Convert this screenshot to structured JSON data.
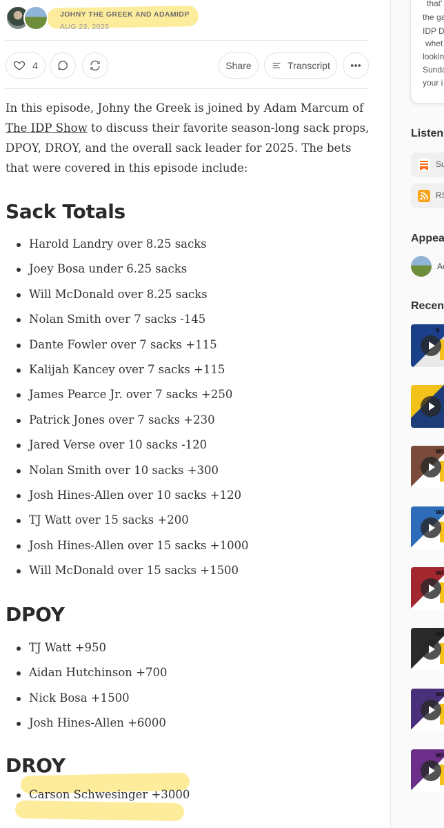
{
  "byline": {
    "authors": "JOHNY THE GREEK AND ADAMIDP",
    "date": "AUG 23, 2025"
  },
  "actions": {
    "like_count": "4",
    "share_label": "Share",
    "transcript_label": "Transcript"
  },
  "intro": {
    "before_link": "In this episode, Johny the Greek is joined by Adam Marcum of ",
    "link_text": "The IDP Show",
    "after_link": " to discuss their favorite season-long sack props, DPOY, DROY, and the overall sack leader for 2025. The bets that were covered in this episode include:"
  },
  "sections": [
    {
      "title": "Sack Totals",
      "items": [
        "Harold Landry over 8.25 sacks",
        "Joey Bosa under 6.25 sacks",
        "Will McDonald over 8.25 sacks",
        "Nolan Smith over 7 sacks -145",
        "Dante Fowler over 7 sacks +115",
        "Kalijah Kancey over 7 sacks +115",
        "James Pearce Jr. over 7 sacks +250",
        "Patrick Jones over 7 sacks +230",
        "Jared Verse over 10 sacks -120",
        "Nolan Smith over 10 sacks +300",
        "Josh Hines-Allen over 10 sacks +120",
        "TJ Watt over 15 sacks +200",
        "Josh Hines-Allen over 15 sacks +1000",
        "Will McDonald over 15 sacks +1500"
      ]
    },
    {
      "title": "DPOY",
      "items": [
        "TJ Watt +950",
        "Aidan Hutchinson +700",
        "Nick Bosa +1500",
        "Josh Hines-Allen +6000"
      ]
    },
    {
      "title": "DROY",
      "items": [
        "Carson Schwesinger +3000"
      ]
    }
  ],
  "sidebar": {
    "card_lines": [
      "that'",
      "the ga",
      "IDP D",
      "whet",
      "lookin",
      "Sunda",
      "your i"
    ],
    "listen_heading": "Listen",
    "listen_buttons": [
      "Su",
      "RS"
    ],
    "appears_heading": "Appear",
    "appears_person": "Ac",
    "recent_heading": "Recent",
    "thumb_badges": [
      "S",
      "",
      "WI",
      "WI",
      "WI",
      "WI",
      "WI",
      "WI"
    ]
  },
  "colors": {
    "highlight": "#fde98a",
    "substack_orange": "#ff6719",
    "rss_orange": "#f7a31c"
  }
}
